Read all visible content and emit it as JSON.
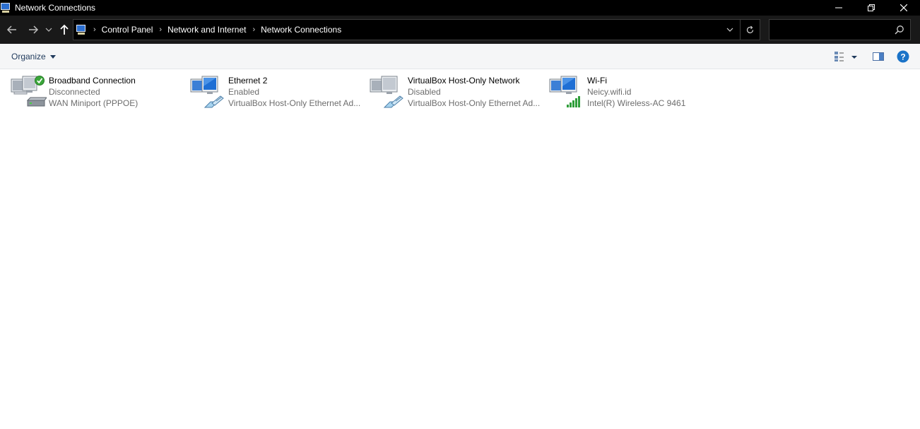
{
  "window": {
    "title": "Network Connections",
    "icon": "network-connections-icon"
  },
  "navigation": {
    "back_icon": "arrow-left-icon",
    "forward_icon": "arrow-right-icon",
    "recent_icon": "chevron-down-icon",
    "up_icon": "arrow-up-icon"
  },
  "address_bar": {
    "breadcrumbs": [
      "Control Panel",
      "Network and Internet",
      "Network Connections"
    ],
    "dropdown_icon": "chevron-down-icon",
    "refresh_icon": "refresh-icon"
  },
  "search": {
    "placeholder": "",
    "value": "",
    "icon": "search-icon"
  },
  "toolbar": {
    "organize_label": "Organize",
    "view_icon": "change-view-icon",
    "preview_icon": "preview-pane-icon",
    "help_icon": "help-icon"
  },
  "connections": [
    {
      "name": "Broadband Connection",
      "status": "Disconnected",
      "device": "WAN Miniport (PPPOE)",
      "icon": "broadband-connection-icon"
    },
    {
      "name": "Ethernet 2",
      "status": "Enabled",
      "device": "VirtualBox Host-Only Ethernet Ad...",
      "icon": "ethernet-connection-icon"
    },
    {
      "name": "VirtualBox Host-Only Network",
      "status": "Disabled",
      "device": "VirtualBox Host-Only Ethernet Ad...",
      "icon": "ethernet-connection-icon"
    },
    {
      "name": "Wi-Fi",
      "status": "Neicy.wifi.id",
      "device": "Intel(R) Wireless-AC 9461",
      "icon": "wifi-connection-icon"
    }
  ],
  "colors": {
    "titlebar_bg": "#000000",
    "addressbar_bg": "#191919",
    "toolbar_bg": "#f5f6f7",
    "link_text": "#1e395b",
    "secondary_text": "#6d6d6d",
    "help_blue": "#1a73c8"
  }
}
